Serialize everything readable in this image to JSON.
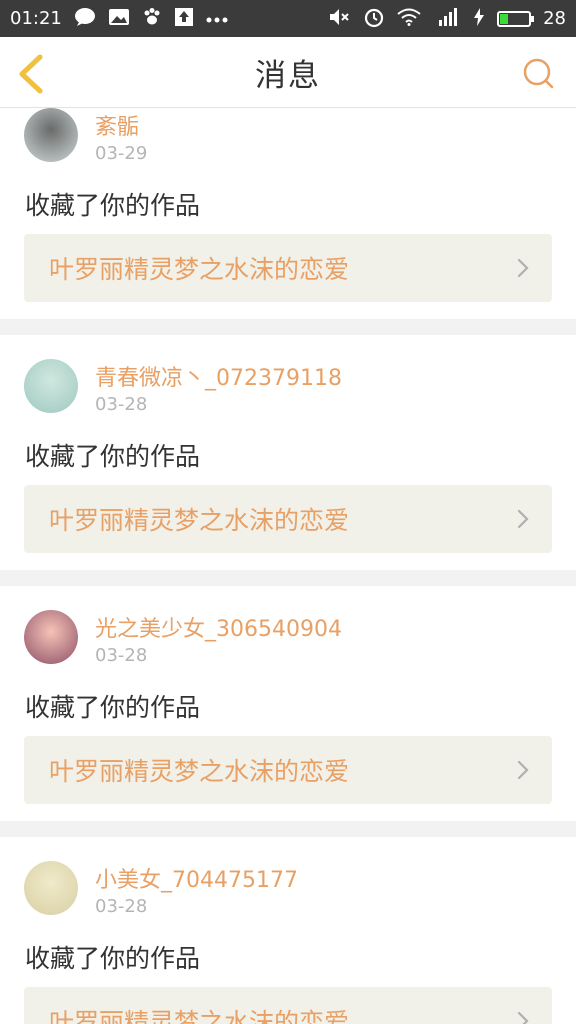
{
  "status_bar": {
    "time": "01:21",
    "battery_level": "28",
    "battery_fraction": 0.28,
    "icons_left": [
      "chat-bubble-icon",
      "gallery-icon",
      "paw-icon",
      "upload-icon",
      "more-dots-icon"
    ],
    "icons_right": [
      "mute-icon",
      "alarm-icon",
      "wifi-icon",
      "signal-4g-icon",
      "charging-icon",
      "battery-icon"
    ]
  },
  "header": {
    "title": "消息",
    "back_icon": "chevron-left-icon",
    "search_icon": "search-icon",
    "accent_color": "#f0c040"
  },
  "colors": {
    "username": "#e8a065",
    "link_bg": "#f1f1e9",
    "date": "#b5b5b5"
  },
  "messages": [
    {
      "username": "紊骺",
      "date": "03-29",
      "action": "收藏了你的作品",
      "work_title": "叶罗丽精灵梦之水沫的恋爱",
      "avatar_colors": [
        "#6a6a6a",
        "#cfd8d8"
      ]
    },
    {
      "username": "青春微凉丶_072379118",
      "date": "03-28",
      "action": "收藏了你的作品",
      "work_title": "叶罗丽精灵梦之水沫的恋爱",
      "avatar_colors": [
        "#cfe8df",
        "#9fc8c0"
      ]
    },
    {
      "username": "光之美少女_306540904",
      "date": "03-28",
      "action": "收藏了你的作品",
      "work_title": "叶罗丽精灵梦之水沫的恋爱",
      "avatar_colors": [
        "#f6c3b7",
        "#8c4f66"
      ]
    },
    {
      "username": "小美女_704475177",
      "date": "03-28",
      "action": "收藏了你的作品",
      "work_title": "叶罗丽精灵梦之水沫的恋爱",
      "avatar_colors": [
        "#f1eacb",
        "#d7cfa2"
      ]
    }
  ]
}
